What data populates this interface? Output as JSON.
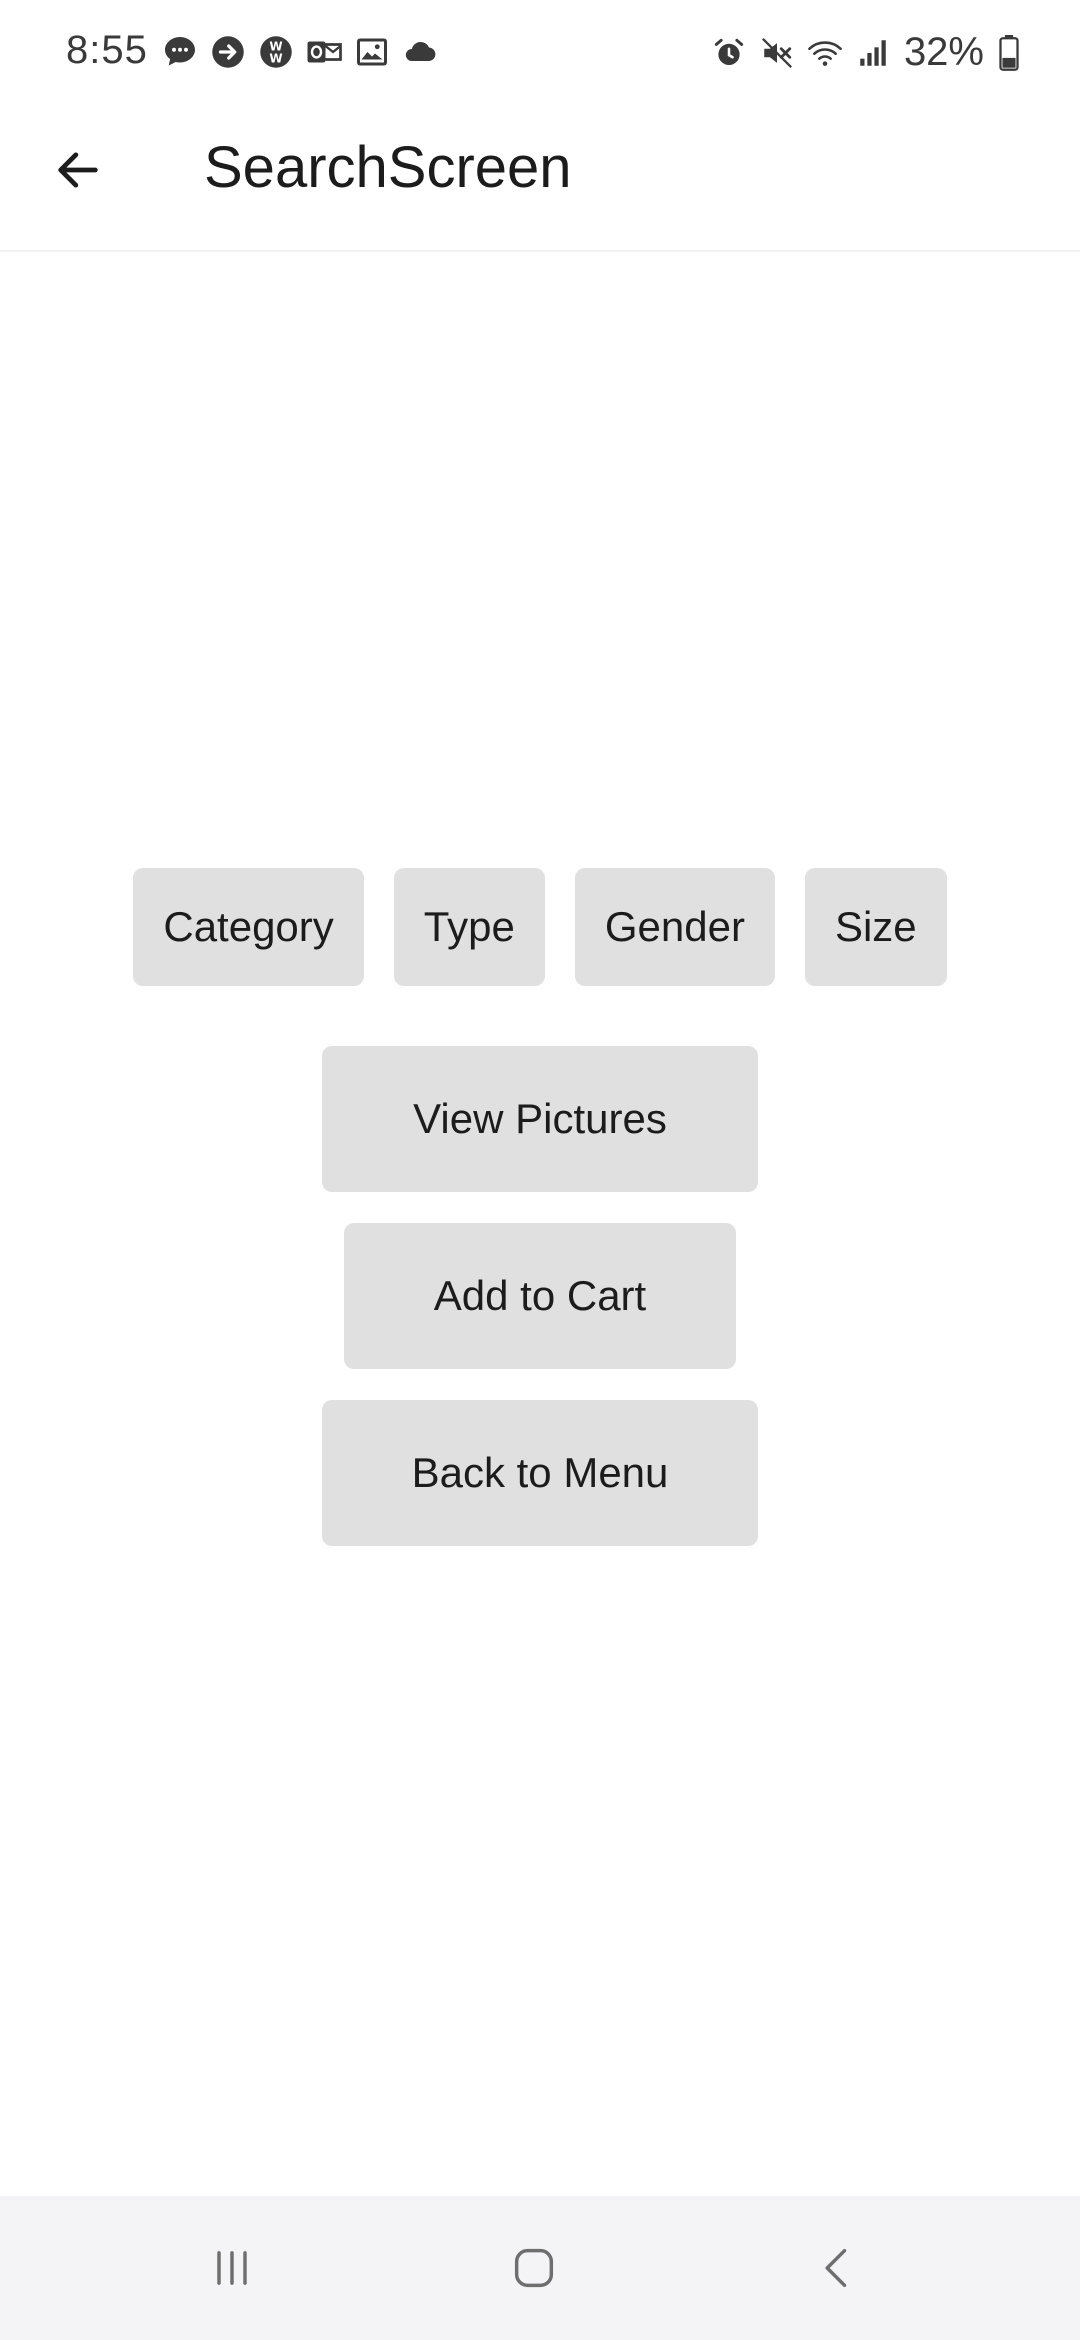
{
  "status_bar": {
    "time": "8:55",
    "notification_icons": [
      "messages-icon",
      "forward-icon",
      "w-app-icon",
      "outlook-icon",
      "gallery-icon",
      "cloud-icon"
    ],
    "system_icons": [
      "alarm-icon",
      "mute-icon",
      "wifi-icon",
      "signal-icon"
    ],
    "battery_percent": "32%"
  },
  "app_bar": {
    "title": "SearchScreen",
    "back_icon": "arrow-left-icon"
  },
  "filters": [
    {
      "label": "Category"
    },
    {
      "label": "Type"
    },
    {
      "label": "Gender"
    },
    {
      "label": "Size"
    }
  ],
  "actions": {
    "view_pictures": "View Pictures",
    "add_to_cart": "Add to Cart",
    "back_to_menu": "Back to Menu"
  },
  "nav_bar": {
    "icons": [
      "recents-icon",
      "home-icon",
      "back-icon"
    ]
  },
  "colors": {
    "button_bg": "#e0e0e0",
    "nav_bg": "#f4f4f6",
    "text": "#1c1c1c"
  }
}
